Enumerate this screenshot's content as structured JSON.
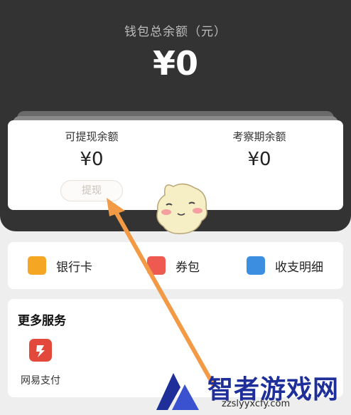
{
  "wallet": {
    "total_label": "钱包总余额（元）",
    "total_amount": "¥0"
  },
  "balances": {
    "withdrawable_label": "可提现余额",
    "withdrawable_amount": "¥0",
    "withdraw_button": "提现",
    "probation_label": "考察期余额",
    "probation_amount": "¥0"
  },
  "quick_actions": [
    {
      "label": "银行卡",
      "icon": "bank-card-icon",
      "color": "#f5a623"
    },
    {
      "label": "券包",
      "icon": "coupon-icon",
      "color": "#ee5a4f"
    },
    {
      "label": "收支明细",
      "icon": "statement-icon",
      "color": "#3c8fe0"
    }
  ],
  "services": {
    "title": "更多服务",
    "items": [
      {
        "label": "网易支付",
        "icon": "netease-pay-icon",
        "color": "#e2493b"
      }
    ]
  },
  "watermark": {
    "brand": "智者游戏网",
    "url": "zzslyyxcfy.com"
  },
  "colors": {
    "header_bg": "#333333",
    "page_bg": "#eeeeee",
    "annotation_arrow": "#f29a45"
  }
}
